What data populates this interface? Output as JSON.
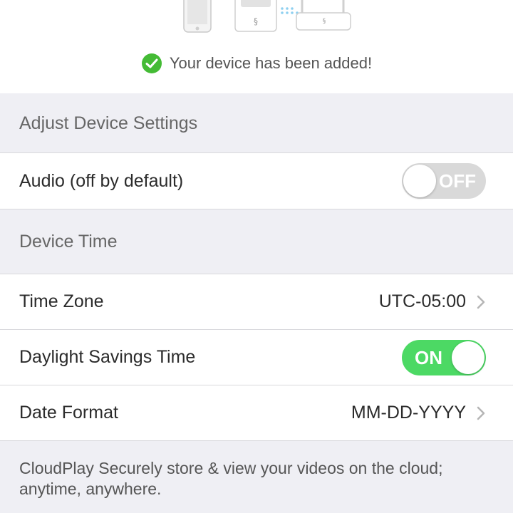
{
  "hero": {
    "illustration": [
      "phone-icon",
      "camera-device-icon",
      "router-icon"
    ],
    "success_icon": "check-circle-icon",
    "success_message": "Your device has been added!",
    "success_color": "#44bb35"
  },
  "adjust_settings": {
    "header": "Adjust Device Settings",
    "audio": {
      "label": "Audio (off by default)",
      "toggle_state": "OFF",
      "enabled": false
    }
  },
  "device_time": {
    "header": "Device Time",
    "time_zone": {
      "label": "Time Zone",
      "value": "UTC-05:00"
    },
    "dst": {
      "label": "Daylight Savings Time",
      "toggle_state": "ON",
      "enabled": true
    },
    "date_format": {
      "label": "Date Format",
      "value": "MM-DD-YYYY"
    }
  },
  "footer": {
    "text": "CloudPlay Securely store & view your videos on the cloud; anytime, anywhere."
  },
  "colors": {
    "toggle_on": "#4cd964",
    "toggle_off": "#d9d9d9",
    "section_bg": "#efeff4"
  }
}
